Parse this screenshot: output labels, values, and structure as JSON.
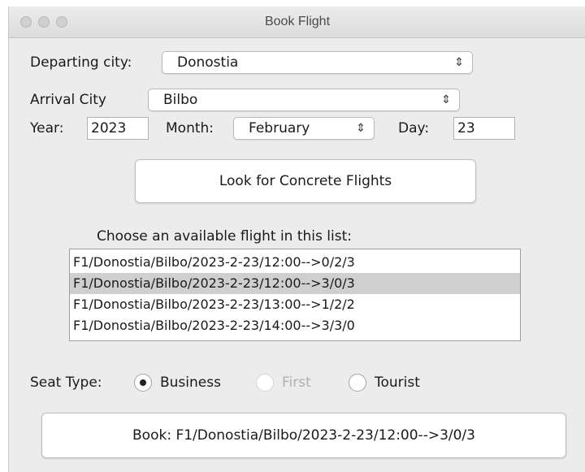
{
  "window": {
    "title": "Book Flight"
  },
  "departing": {
    "label": "Departing city:",
    "value": "Donostia"
  },
  "arrival": {
    "label": "Arrival City",
    "value": "Bilbo"
  },
  "date": {
    "year_label": "Year:",
    "year": "2023",
    "month_label": "Month:",
    "month": "February",
    "day_label": "Day:",
    "day": "23"
  },
  "search_button": "Look for Concrete Flights",
  "flights": {
    "label": "Choose an available flight in this list:",
    "items": [
      "F1/Donostia/Bilbo/2023-2-23/12:00-->0/2/3",
      "F1/Donostia/Bilbo/2023-2-23/12:00-->3/0/3",
      "F1/Donostia/Bilbo/2023-2-23/13:00-->1/2/2",
      "F1/Donostia/Bilbo/2023-2-23/14:00-->3/3/0"
    ],
    "selected_index": 1
  },
  "seat": {
    "label": "Seat Type:",
    "options": [
      "Business",
      "First",
      "Tourist"
    ],
    "selected": "Business",
    "disabled": [
      "First"
    ]
  },
  "book_button": "Book: F1/Donostia/Bilbo/2023-2-23/12:00-->3/0/3",
  "colors": {
    "selected_row": "#cfcfcf",
    "window_bg": "#ececec",
    "disabled_text": "#b0b0b0"
  },
  "icons": [
    "close-icon",
    "minimize-icon",
    "zoom-icon",
    "chevron-updown-icon",
    "radio-button-icon"
  ]
}
